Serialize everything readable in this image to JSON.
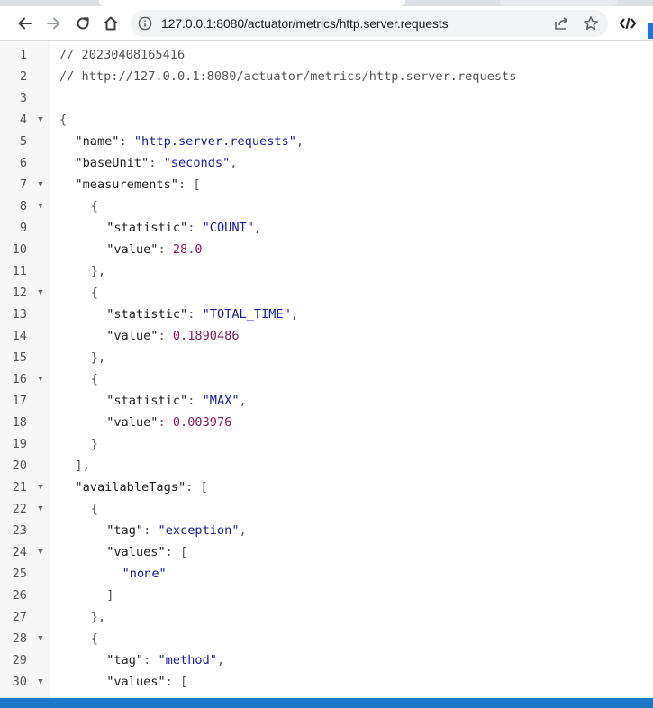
{
  "browser": {
    "url": "127.0.0.1:8080/actuator/metrics/http.server.requests",
    "accent_color": "#1a73e8"
  },
  "viewer": {
    "lines": [
      {
        "n": "1",
        "fold": "",
        "indent": 0,
        "tokens": [
          {
            "t": "// 20230408165416",
            "c": "comment"
          }
        ]
      },
      {
        "n": "2",
        "fold": "",
        "indent": 0,
        "tokens": [
          {
            "t": "// http://127.0.0.1:8080/actuator/metrics/http.server.requests",
            "c": "comment"
          }
        ]
      },
      {
        "n": "3",
        "fold": "",
        "indent": 0,
        "tokens": []
      },
      {
        "n": "4",
        "fold": "▼",
        "indent": 0,
        "tokens": [
          {
            "t": "{",
            "c": "punc"
          }
        ]
      },
      {
        "n": "5",
        "fold": "",
        "indent": 1,
        "tokens": [
          {
            "t": "\"name\"",
            "c": "key"
          },
          {
            "t": ": ",
            "c": "punc"
          },
          {
            "t": "\"http.server.requests\"",
            "c": "str"
          },
          {
            "t": ",",
            "c": "punc"
          }
        ]
      },
      {
        "n": "6",
        "fold": "",
        "indent": 1,
        "tokens": [
          {
            "t": "\"baseUnit\"",
            "c": "key"
          },
          {
            "t": ": ",
            "c": "punc"
          },
          {
            "t": "\"seconds\"",
            "c": "str"
          },
          {
            "t": ",",
            "c": "punc"
          }
        ]
      },
      {
        "n": "7",
        "fold": "▼",
        "indent": 1,
        "tokens": [
          {
            "t": "\"measurements\"",
            "c": "key"
          },
          {
            "t": ": [",
            "c": "punc"
          }
        ]
      },
      {
        "n": "8",
        "fold": "▼",
        "indent": 2,
        "tokens": [
          {
            "t": "{",
            "c": "punc"
          }
        ]
      },
      {
        "n": "9",
        "fold": "",
        "indent": 3,
        "tokens": [
          {
            "t": "\"statistic\"",
            "c": "key"
          },
          {
            "t": ": ",
            "c": "punc"
          },
          {
            "t": "\"COUNT\"",
            "c": "str"
          },
          {
            "t": ",",
            "c": "punc"
          }
        ]
      },
      {
        "n": "10",
        "fold": "",
        "indent": 3,
        "tokens": [
          {
            "t": "\"value\"",
            "c": "key"
          },
          {
            "t": ": ",
            "c": "punc"
          },
          {
            "t": "28.0",
            "c": "num"
          }
        ]
      },
      {
        "n": "11",
        "fold": "",
        "indent": 2,
        "tokens": [
          {
            "t": "},",
            "c": "punc"
          }
        ]
      },
      {
        "n": "12",
        "fold": "▼",
        "indent": 2,
        "tokens": [
          {
            "t": "{",
            "c": "punc"
          }
        ]
      },
      {
        "n": "13",
        "fold": "",
        "indent": 3,
        "tokens": [
          {
            "t": "\"statistic\"",
            "c": "key"
          },
          {
            "t": ": ",
            "c": "punc"
          },
          {
            "t": "\"TOTAL_TIME\"",
            "c": "str"
          },
          {
            "t": ",",
            "c": "punc"
          }
        ]
      },
      {
        "n": "14",
        "fold": "",
        "indent": 3,
        "tokens": [
          {
            "t": "\"value\"",
            "c": "key"
          },
          {
            "t": ": ",
            "c": "punc"
          },
          {
            "t": "0.1890486",
            "c": "num"
          }
        ]
      },
      {
        "n": "15",
        "fold": "",
        "indent": 2,
        "tokens": [
          {
            "t": "},",
            "c": "punc"
          }
        ]
      },
      {
        "n": "16",
        "fold": "▼",
        "indent": 2,
        "tokens": [
          {
            "t": "{",
            "c": "punc"
          }
        ]
      },
      {
        "n": "17",
        "fold": "",
        "indent": 3,
        "tokens": [
          {
            "t": "\"statistic\"",
            "c": "key"
          },
          {
            "t": ": ",
            "c": "punc"
          },
          {
            "t": "\"MAX\"",
            "c": "str"
          },
          {
            "t": ",",
            "c": "punc"
          }
        ]
      },
      {
        "n": "18",
        "fold": "",
        "indent": 3,
        "tokens": [
          {
            "t": "\"value\"",
            "c": "key"
          },
          {
            "t": ": ",
            "c": "punc"
          },
          {
            "t": "0.003976",
            "c": "num"
          }
        ]
      },
      {
        "n": "19",
        "fold": "",
        "indent": 2,
        "tokens": [
          {
            "t": "}",
            "c": "punc"
          }
        ]
      },
      {
        "n": "20",
        "fold": "",
        "indent": 1,
        "tokens": [
          {
            "t": "],",
            "c": "punc"
          }
        ]
      },
      {
        "n": "21",
        "fold": "▼",
        "indent": 1,
        "tokens": [
          {
            "t": "\"availableTags\"",
            "c": "key"
          },
          {
            "t": ": [",
            "c": "punc"
          }
        ]
      },
      {
        "n": "22",
        "fold": "▼",
        "indent": 2,
        "tokens": [
          {
            "t": "{",
            "c": "punc"
          }
        ]
      },
      {
        "n": "23",
        "fold": "",
        "indent": 3,
        "tokens": [
          {
            "t": "\"tag\"",
            "c": "key"
          },
          {
            "t": ": ",
            "c": "punc"
          },
          {
            "t": "\"exception\"",
            "c": "str"
          },
          {
            "t": ",",
            "c": "punc"
          }
        ]
      },
      {
        "n": "24",
        "fold": "▼",
        "indent": 3,
        "tokens": [
          {
            "t": "\"values\"",
            "c": "key"
          },
          {
            "t": ": [",
            "c": "punc"
          }
        ]
      },
      {
        "n": "25",
        "fold": "",
        "indent": 4,
        "tokens": [
          {
            "t": "\"none\"",
            "c": "str"
          }
        ]
      },
      {
        "n": "26",
        "fold": "",
        "indent": 3,
        "tokens": [
          {
            "t": "]",
            "c": "punc"
          }
        ]
      },
      {
        "n": "27",
        "fold": "",
        "indent": 2,
        "tokens": [
          {
            "t": "},",
            "c": "punc"
          }
        ]
      },
      {
        "n": "28",
        "fold": "▼",
        "indent": 2,
        "tokens": [
          {
            "t": "{",
            "c": "punc"
          }
        ]
      },
      {
        "n": "29",
        "fold": "",
        "indent": 3,
        "tokens": [
          {
            "t": "\"tag\"",
            "c": "key"
          },
          {
            "t": ": ",
            "c": "punc"
          },
          {
            "t": "\"method\"",
            "c": "str"
          },
          {
            "t": ",",
            "c": "punc"
          }
        ]
      },
      {
        "n": "30",
        "fold": "▼",
        "indent": 3,
        "tokens": [
          {
            "t": "\"values\"",
            "c": "key"
          },
          {
            "t": ": [",
            "c": "punc"
          }
        ]
      }
    ]
  }
}
